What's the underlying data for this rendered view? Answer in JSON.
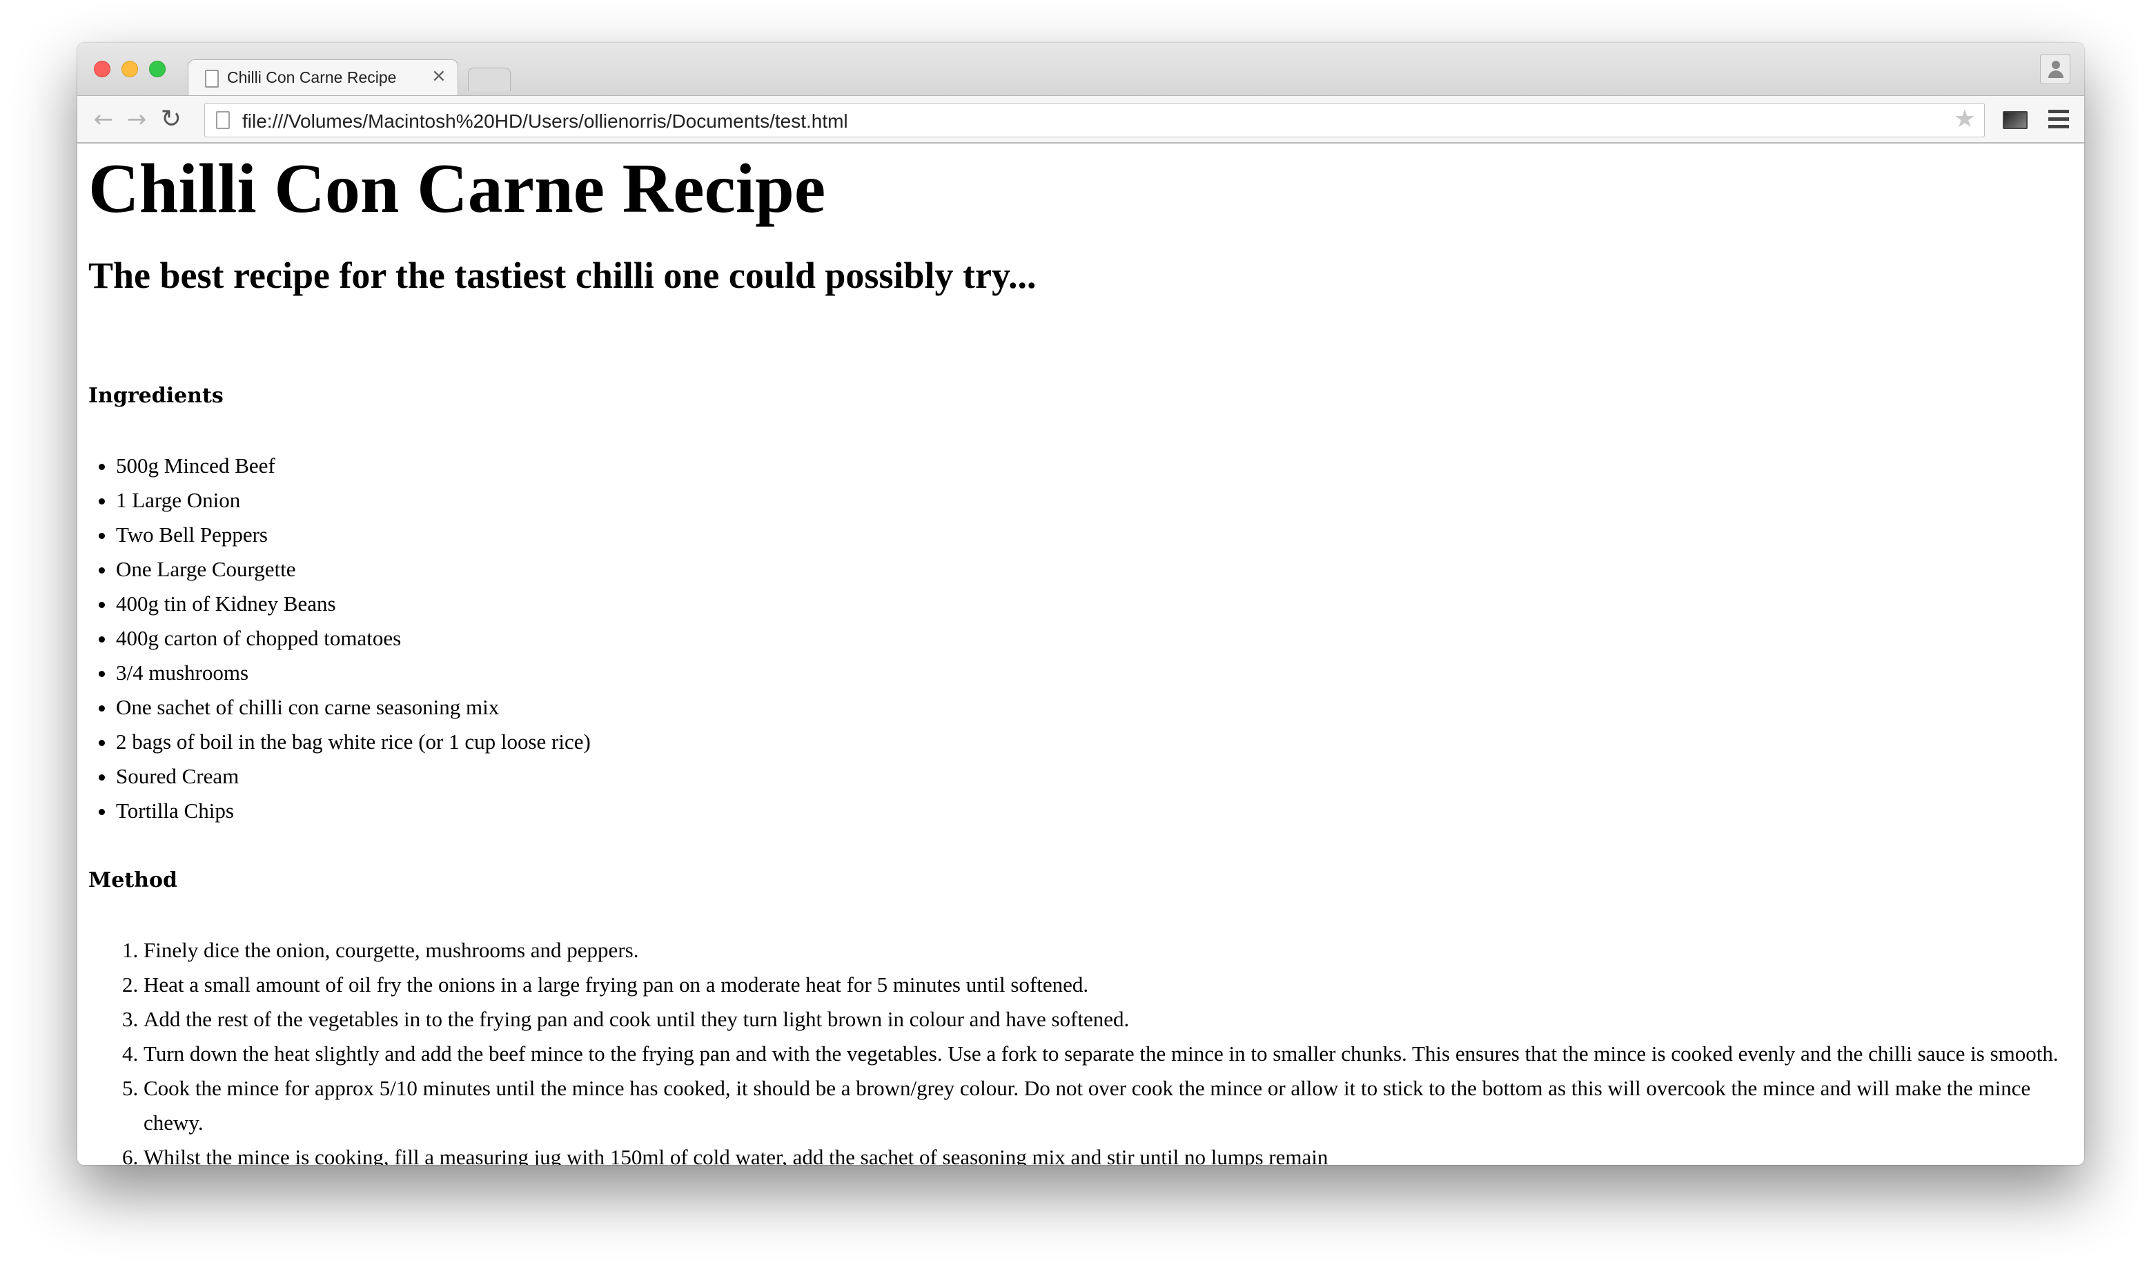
{
  "browser": {
    "tab_title": "Chilli Con Carne Recipe",
    "tab_close": "×",
    "url": "file:///Volumes/Macintosh%20HD/Users/ollienorris/Documents/test.html",
    "back_icon": "←",
    "forward_icon": "→",
    "reload_icon": "↻",
    "star_icon": "★"
  },
  "page": {
    "title": "Chilli Con Carne Recipe",
    "subtitle": "The best recipe for the tastiest chilli one could possibly try...",
    "ingredients_heading": "Ingredients",
    "ingredients": [
      "500g Minced Beef",
      "1 Large Onion",
      "Two Bell Peppers",
      "One Large Courgette",
      "400g tin of Kidney Beans",
      "400g carton of chopped tomatoes",
      "3/4 mushrooms",
      "One sachet of chilli con carne seasoning mix",
      "2 bags of boil in the bag white rice (or 1 cup loose rice)",
      "Soured Cream",
      "Tortilla Chips"
    ],
    "method_heading": "Method",
    "method": [
      "Finely dice the onion, courgette, mushrooms and peppers.",
      "Heat a small amount of oil fry the onions in a large frying pan on a moderate heat for 5 minutes until softened.",
      "Add the rest of the vegetables in to the frying pan and cook until they turn light brown in colour and have softened.",
      "Turn down the heat slightly and add the beef mince to the frying pan and with the vegetables. Use a fork to separate the mince in to smaller chunks. This ensures that the mince is cooked evenly and the chilli sauce is smooth.",
      "Cook the mince for approx 5/10 minutes until the mince has cooked, it should be a brown/grey colour. Do not over cook the mince or allow it to stick to the bottom as this will overcook the mince and will make the mince chewy.",
      "Whilst the mince is cooking, fill a measuring jug with 150ml of cold water, add the sachet of seasoning mix and stir until no lumps remain"
    ]
  }
}
